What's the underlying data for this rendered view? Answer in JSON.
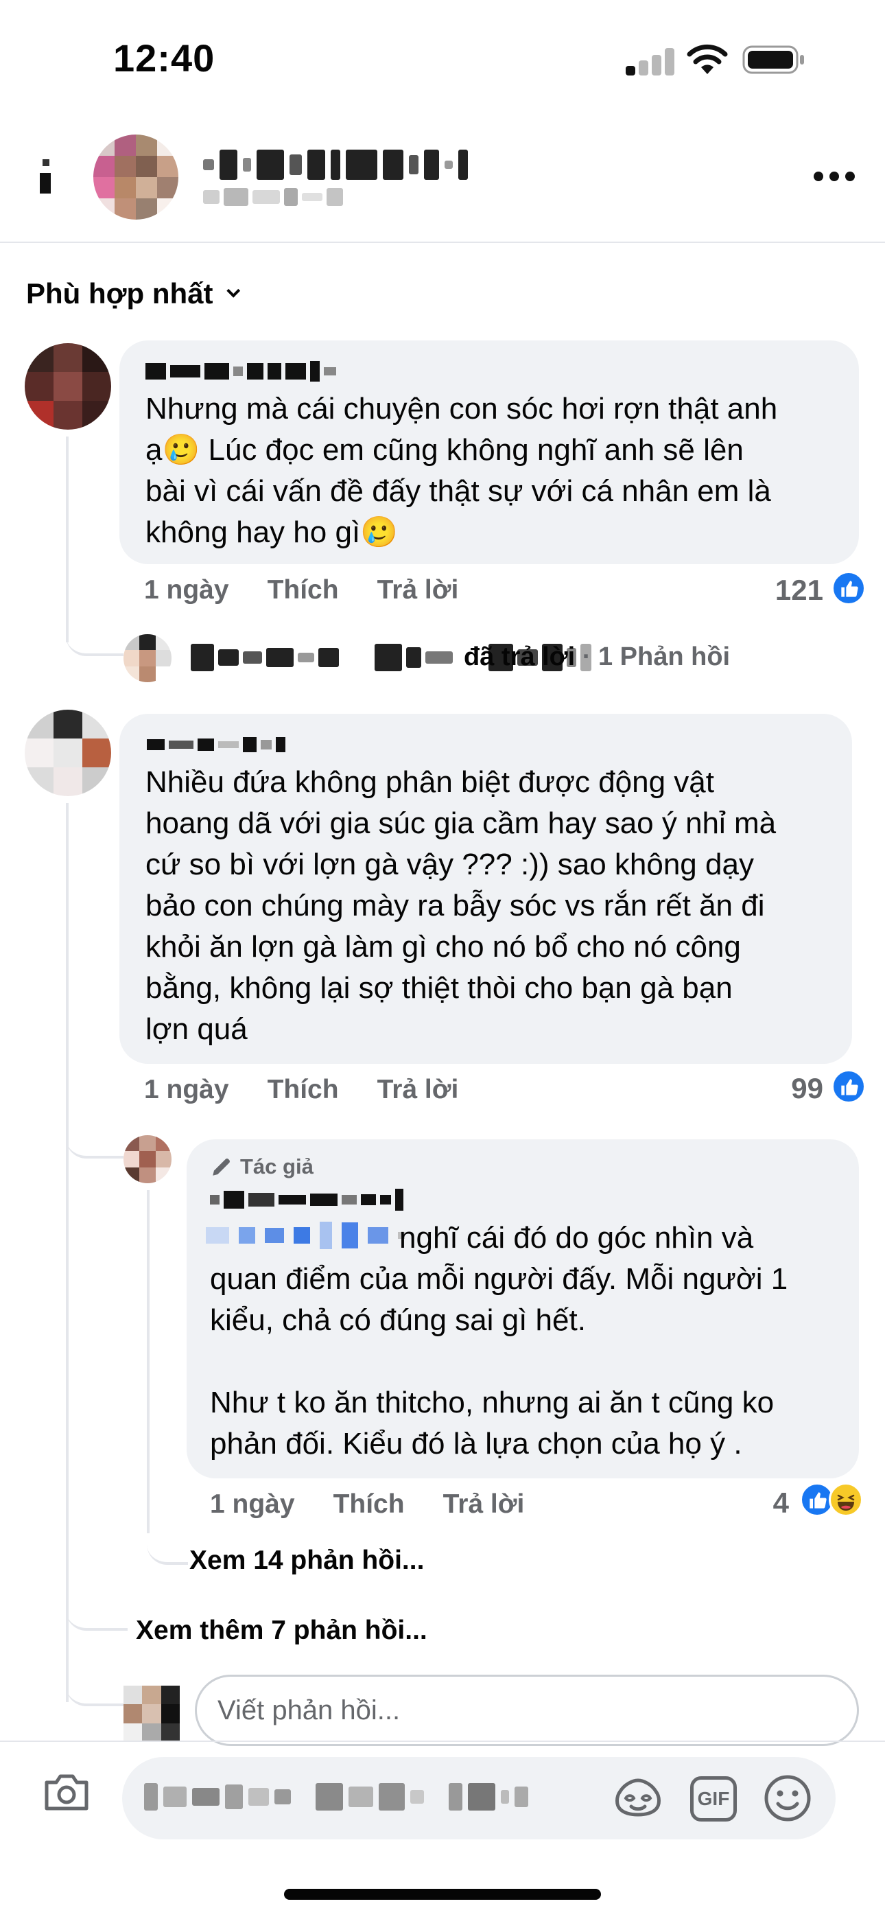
{
  "status_bar": {
    "time": "12:40"
  },
  "sort": {
    "label": "Phù hợp nhất"
  },
  "comments": [
    {
      "text": "Nhưng mà cái chuyện con sóc hơi rợn thật anh\nạ🥲 Lúc đọc em cũng không nghĩ anh sẽ lên\nbài vì cái vấn đề đấy thật sự với cá nhân em là\nkhông hay ho gì🥲",
      "time": "1 ngày",
      "like_label": "Thích",
      "reply_label": "Trả lời",
      "reaction_count": "121",
      "reply_summary": {
        "action": "đã trả lời",
        "count": "1 Phản hồi"
      }
    },
    {
      "text": "Nhiều đứa không phân biệt được động vật\nhoang dã với gia súc gia cầm hay sao ý nhỉ mà\ncứ so bì với lợn gà vậy ??? :)) sao không dạy\nbảo con chúng mày ra bẫy sóc vs rắn rết ăn đi\nkhỏi ăn lợn gà làm gì cho nó bổ cho nó công\nbằng, không lại sợ thiệt thòi cho bạn gà bạn\nlợn quá",
      "time": "1 ngày",
      "like_label": "Thích",
      "reply_label": "Trả lời",
      "reaction_count": "99",
      "reply": {
        "badge": "Tác giả",
        "text_first_line": "nghĩ cái đó do góc nhìn và",
        "text": "quan điểm của mỗi người đấy. Mỗi người 1\nkiểu, chả có đúng sai gì hết.\n\nNhư t ko ăn thitcho, nhưng ai ăn t cũng ko\nphản đối. Kiểu đó là lựa chọn của họ ý .",
        "time": "1 ngày",
        "like_label": "Thích",
        "reply_label": "Trả lời",
        "reaction_count": "4",
        "view_replies": "Xem 14 phản hồi..."
      },
      "view_more": "Xem thêm 7 phản hồi..."
    }
  ],
  "reply_input": {
    "placeholder": "Viết phản hồi..."
  },
  "composer": {
    "gif_label": "GIF"
  },
  "colors": {
    "like_blue": "#1877f2",
    "meta_gray": "#65676b",
    "bubble_bg": "#f0f2f5"
  }
}
